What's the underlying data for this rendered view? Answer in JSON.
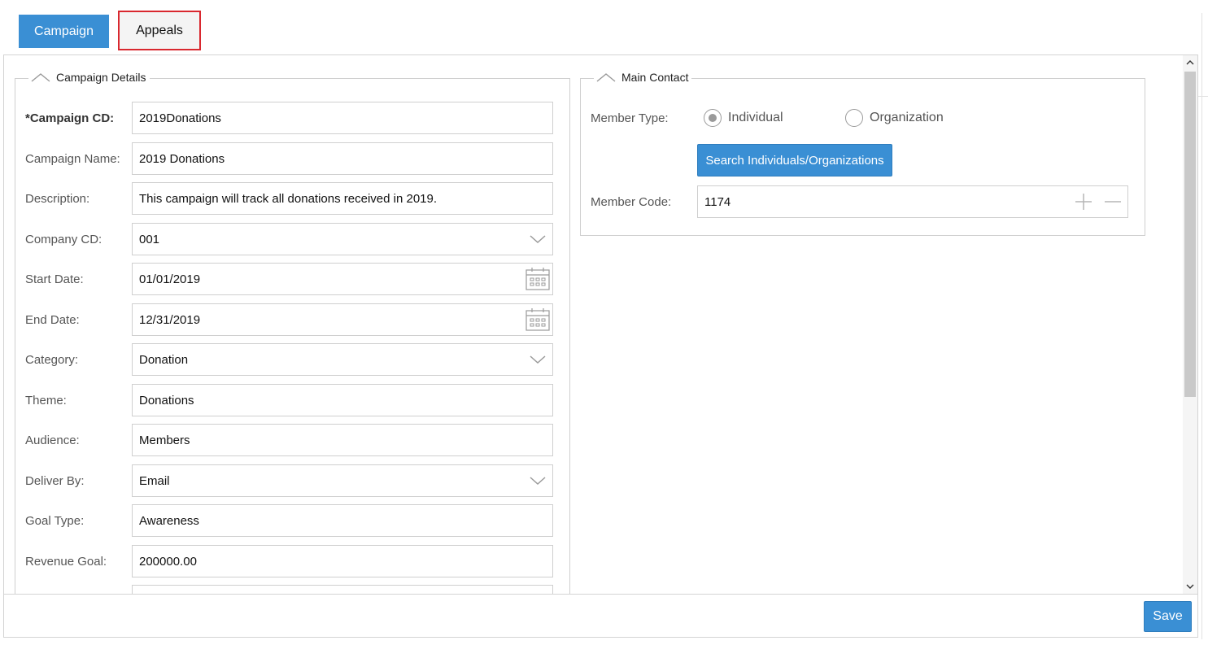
{
  "tabs": {
    "campaign": "Campaign",
    "appeals": "Appeals"
  },
  "campaign_details": {
    "title": "Campaign Details",
    "fields": [
      {
        "label": "*Campaign CD:",
        "value": "2019Donations",
        "type": "text",
        "required": true
      },
      {
        "label": "Campaign Name:",
        "value": "2019 Donations",
        "type": "text"
      },
      {
        "label": "Description:",
        "value": "This campaign will track all donations received in 2019.",
        "type": "text"
      },
      {
        "label": "Company CD:",
        "value": "001",
        "type": "select"
      },
      {
        "label": "Start Date:",
        "value": "01/01/2019",
        "type": "date"
      },
      {
        "label": "End Date:",
        "value": "12/31/2019",
        "type": "date"
      },
      {
        "label": "Category:",
        "value": "Donation",
        "type": "select"
      },
      {
        "label": "Theme:",
        "value": "Donations",
        "type": "text"
      },
      {
        "label": "Audience:",
        "value": "Members",
        "type": "text"
      },
      {
        "label": "Deliver By:",
        "value": "Email",
        "type": "select"
      },
      {
        "label": "Goal Type:",
        "value": "Awareness",
        "type": "text"
      },
      {
        "label": "Revenue Goal:",
        "value": "200000.00",
        "type": "text"
      }
    ]
  },
  "main_contact": {
    "title": "Main Contact",
    "member_type_label": "Member Type:",
    "options": [
      "Individual",
      "Organization"
    ],
    "selected": "Individual",
    "search_button": "Search Individuals/Organizations",
    "member_code_label": "Member Code:",
    "member_code_value": "1174"
  },
  "footer": {
    "save_label": "Save"
  },
  "colors": {
    "accent": "#3a8fd4",
    "highlight_border": "#d9282f"
  }
}
